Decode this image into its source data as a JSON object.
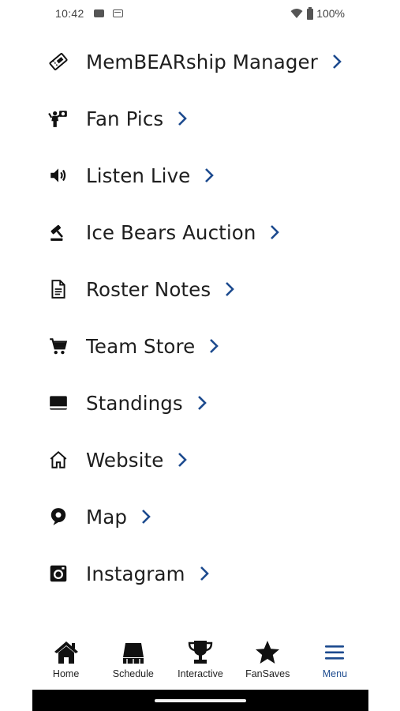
{
  "status_bar": {
    "time": "10:42",
    "battery": "100%"
  },
  "colors": {
    "accent": "#1c4a8e",
    "text": "#1e1e1e",
    "icon": "#111111"
  },
  "menu": {
    "items": [
      {
        "label": "MemBEARship Manager",
        "icon": "ticket-icon"
      },
      {
        "label": "Fan Pics",
        "icon": "fan-photo-icon"
      },
      {
        "label": "Listen Live",
        "icon": "speaker-icon"
      },
      {
        "label": "Ice Bears Auction",
        "icon": "gavel-icon"
      },
      {
        "label": "Roster Notes",
        "icon": "document-icon"
      },
      {
        "label": "Team Store",
        "icon": "cart-icon"
      },
      {
        "label": "Standings",
        "icon": "standings-icon"
      },
      {
        "label": "Website",
        "icon": "home-outline-icon"
      },
      {
        "label": "Map",
        "icon": "map-pin-icon"
      },
      {
        "label": "Instagram",
        "icon": "instagram-icon"
      }
    ]
  },
  "bottom_nav": {
    "tabs": [
      {
        "label": "Home",
        "icon": "home-icon",
        "active": false
      },
      {
        "label": "Schedule",
        "icon": "schedule-icon",
        "active": false
      },
      {
        "label": "Interactive",
        "icon": "trophy-icon",
        "active": false
      },
      {
        "label": "FanSaves",
        "icon": "star-icon",
        "active": false
      },
      {
        "label": "Menu",
        "icon": "hamburger-menu-icon",
        "active": true
      }
    ]
  }
}
